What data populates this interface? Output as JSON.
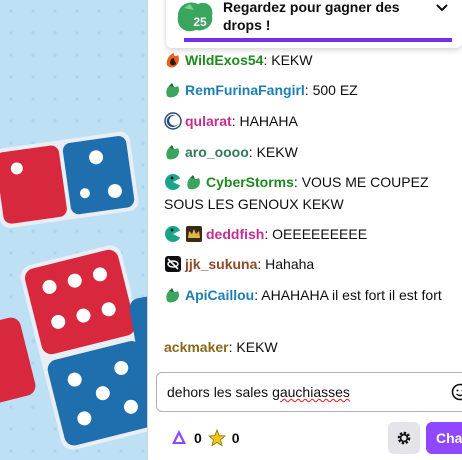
{
  "drops": {
    "badge_number": "25",
    "text": "Regardez pour gagner des drops !"
  },
  "messages": [
    {
      "user": "WildExos54",
      "text": "KEKW",
      "color": "#1e8a1e",
      "badges": [
        "fire-dragon-badge"
      ]
    },
    {
      "user": "RemFurinaFangirl",
      "text": "500 EZ",
      "color": "#1b7fb5",
      "badges": [
        "green-dragon-badge"
      ]
    },
    {
      "user": "qularat",
      "text": "HAHAHA",
      "color": "#c52e8e",
      "badges": [
        "moon-badge"
      ]
    },
    {
      "user": "aro_oooo",
      "text": "KEKW",
      "color": "#2f7a5a",
      "badges": [
        "green-dragon-badge"
      ]
    },
    {
      "user": "CyberStorms",
      "text": "VOUS ME COUPEZ SOUS LES GENOUX KEKW",
      "color": "#1e8a1e",
      "badges": [
        "pacman-badge",
        "green-dragon-badge"
      ]
    },
    {
      "user": "deddfish",
      "text": "OEEEEEEEEE",
      "color": "#c52e8e",
      "badges": [
        "pacman-badge",
        "crown-badge"
      ]
    },
    {
      "user": "jjk_sukuna",
      "text": "Hahaha",
      "color": "#8a4b2d",
      "badges": [
        "eye-slash-badge"
      ]
    },
    {
      "user": "ApiCaillou",
      "text": "AHAHAHA il est fort il est fort",
      "color": "#1b7fb5",
      "badges": [
        "green-dragon-badge"
      ]
    },
    {
      "user": "ackmaker",
      "text": "KEKW",
      "color": "#8a6a1a",
      "badges": []
    }
  ],
  "sep": ": ",
  "input": {
    "before": "dehors les sales ",
    "misspelled": "gauchiasses"
  },
  "points": {
    "channel_points": "0",
    "bits": "0"
  },
  "chat_button_label": "Cha"
}
